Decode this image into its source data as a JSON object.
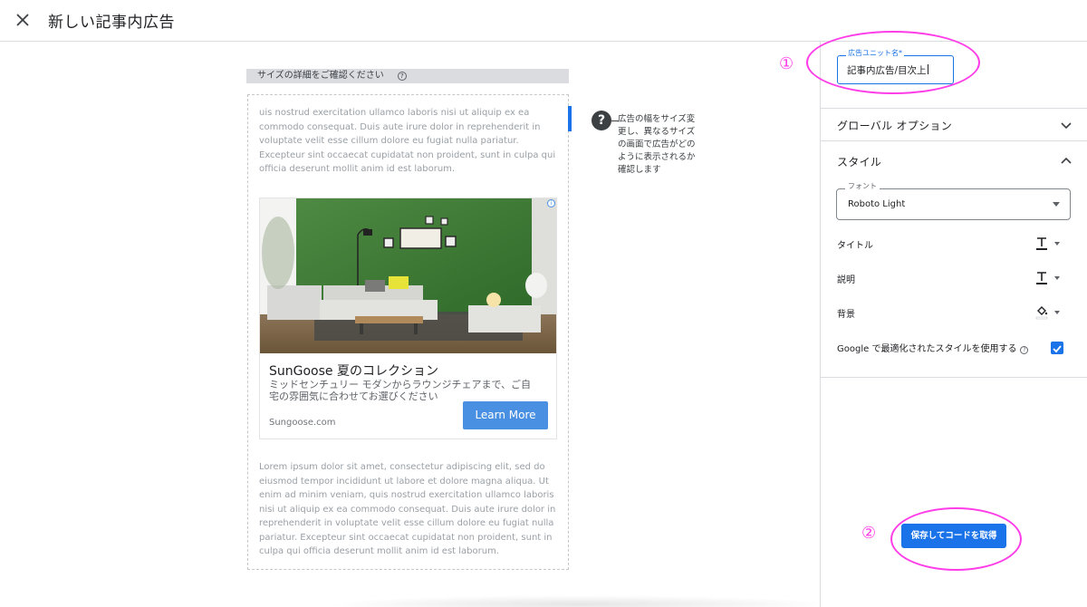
{
  "header": {
    "close_icon": "close-icon",
    "title": "新しい記事内広告"
  },
  "preview": {
    "size_bar_label": "サイズの詳細をご確認ください",
    "size_help": "?",
    "lorem_top": "uis nostrud exercitation ullamco laboris nisi ut aliquip ex ea commodo consequat. Duis aute irure dolor in reprehenderit in voluptate velit esse cillum dolore eu fugiat nulla pariatur. Excepteur sint occaecat cupidatat non proident, sunt in culpa qui officia deserunt mollit anim id est laborum.",
    "lorem_bottom": "Lorem ipsum dolor sit amet, consectetur adipiscing elit, sed do eiusmod tempor incididunt ut labore et dolore magna aliqua. Ut enim ad minim veniam, quis nostrud exercitation ullamco laboris nisi ut aliquip ex ea commodo consequat. Duis aute irure dolor in reprehenderit in voluptate velit esse cillum dolore eu fugiat nulla pariatur. Excepteur sint occaecat cupidatat non proident, sunt in culpa qui officia deserunt mollit anim id est laborum.",
    "ad": {
      "info_icon": "i",
      "title": "SunGoose 夏のコレクション",
      "description": "ミッドセンチュリー モダンからラウンジチェアまで、ご自宅の雰囲気に合わせてお選びください",
      "domain": "Sungoose.com",
      "cta": "Learn More"
    },
    "resize_help_icon": "?",
    "resize_help_text": "広告の幅をサイズ変更し、異なるサイズの画面で広告がどのように表示されるか確認します"
  },
  "panel": {
    "marker_1": "①",
    "marker_2": "②",
    "ad_unit_name": {
      "label": "広告ユニット名*",
      "value": "記事内広告/目次上"
    },
    "global_options_label": "グローバル オプション",
    "style_label": "スタイル",
    "font": {
      "label": "フォント",
      "value": "Roboto Light"
    },
    "options": [
      {
        "label": "タイトル",
        "tool": "text-color-icon"
      },
      {
        "label": "説明",
        "tool": "text-color-icon"
      },
      {
        "label": "背景",
        "tool": "fill-color-icon"
      }
    ],
    "google_optimized_label": "Google で最適化されたスタイルを使用する",
    "google_optimized_checked": true,
    "save_button": "保存してコードを取得"
  },
  "colors": {
    "accent": "#1a73e8",
    "annotation": "#ff3de8",
    "cta": "#4a90e2"
  }
}
